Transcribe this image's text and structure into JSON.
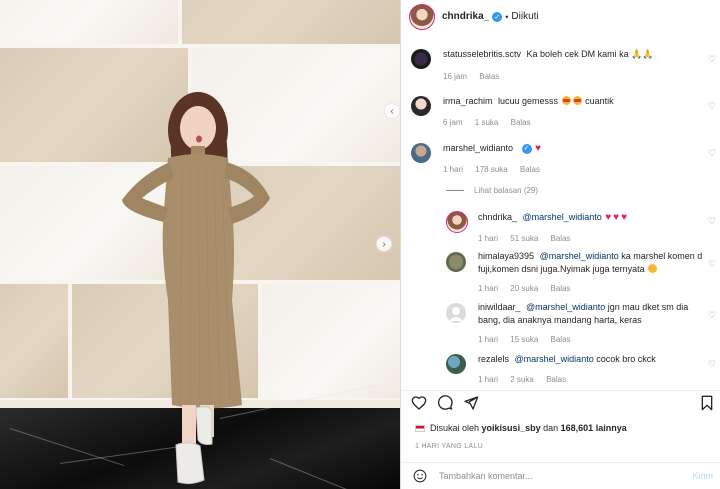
{
  "header": {
    "username": "chndrika_",
    "separator": "•",
    "follow_status": "Diikuti"
  },
  "comments": [
    {
      "username": "statusselebritis.sctv",
      "text": "Ka boleh cek DM kami ka",
      "emoji": "🙏🙏",
      "time": "16 jam",
      "likes": "",
      "reply": "Balas"
    },
    {
      "username": "irma_rachim",
      "text": "lucuu gemesss",
      "trail": "cuantik",
      "time": "6 jam",
      "likes": "1 suka",
      "reply": "Balas"
    },
    {
      "username": "marshel_widianto",
      "text": "",
      "time": "1 hari",
      "likes": "178 suka",
      "reply": "Balas",
      "view_replies": "Lihat balasan (29)"
    }
  ],
  "replies": [
    {
      "username": "chndrika_",
      "mention": "@marshel_widianto",
      "text": "",
      "time": "1 hari",
      "likes": "51 suka",
      "reply": "Balas"
    },
    {
      "username": "himalaya9395",
      "mention": "@marshel_widianto",
      "text": "ka marshel komen d fuji,komen dsni juga.Nyimak juga ternyata",
      "time": "1 hari",
      "likes": "20 suka",
      "reply": "Balas"
    },
    {
      "username": "iniwildaar_",
      "mention": "@marshel_widianto",
      "text": "jgn mau dket sm dia bang, dia anaknya mandang harta, keras",
      "time": "1 hari",
      "likes": "15 suka",
      "reply": "Balas"
    },
    {
      "username": "rezalels",
      "mention": "@marshel_widianto",
      "text": "cocok bro ckck",
      "time": "1 hari",
      "likes": "2 suka",
      "reply": "Balas"
    }
  ],
  "likes_line": {
    "prefix": "Disukai oleh",
    "liker": "yoikisusi_sby",
    "middle": "dan",
    "count": "168,601 lainnya"
  },
  "post_time": "1 HARI YANG LALU",
  "add_comment": {
    "placeholder": "Tambahkan komentar...",
    "send": "Kirim"
  },
  "icons": [
    "heart-icon",
    "comment-icon",
    "share-icon",
    "bookmark-icon",
    "emoji-icon",
    "verified-badge-icon",
    "chevron-right-icon"
  ],
  "colors": {
    "verified": "#3897f0",
    "mention": "#00376b",
    "muted": "#8e8e8e",
    "send_disabled": "#b2dffc",
    "story_ring": "#d62976"
  }
}
